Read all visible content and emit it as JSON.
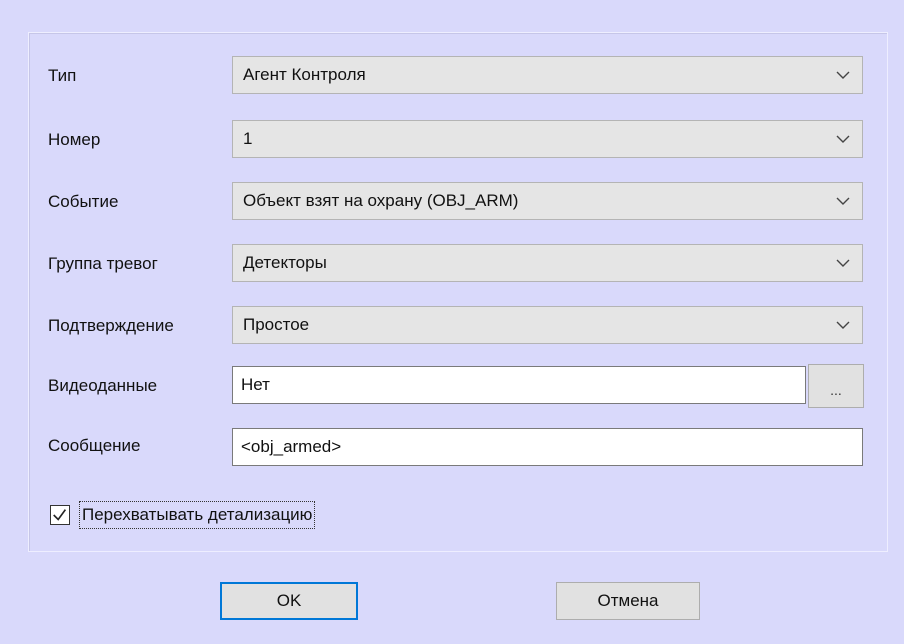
{
  "form": {
    "type": {
      "label": "Тип",
      "value": "Агент Контроля"
    },
    "number": {
      "label": "Номер",
      "value": "1"
    },
    "event": {
      "label": "Событие",
      "value": "Объект взят на охрану (OBJ_ARM)"
    },
    "alarm_group": {
      "label": "Группа тревог",
      "value": "Детекторы"
    },
    "confirmation": {
      "label": "Подтверждение",
      "value": "Простое"
    },
    "video": {
      "label": "Видеоданные",
      "value": "Нет",
      "browse_label": "..."
    },
    "message": {
      "label": "Сообщение",
      "value": "<obj_armed>"
    },
    "intercept": {
      "label": "Перехватывать детализацию",
      "checked": true
    }
  },
  "buttons": {
    "ok_label": "OK",
    "cancel_label": "Отмена"
  },
  "icons": {
    "dropdown": "chevron-down-icon",
    "check": "checkmark-icon"
  },
  "colors": {
    "dialog_background": "#d9d9fb",
    "focus_border": "#0078d7"
  }
}
